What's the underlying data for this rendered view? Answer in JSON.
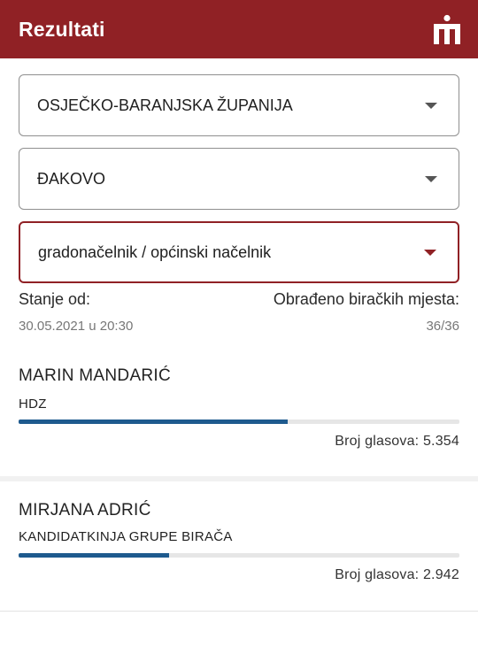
{
  "header": {
    "title": "Rezultati",
    "logo_icon": "hrt-logo-icon",
    "brand_color": "#902125"
  },
  "filters": {
    "county": "OSJEČKO-BARANJSKA ŽUPANIJA",
    "city": "ĐAKOVO",
    "office": "gradonačelnik / općinski načelnik"
  },
  "status": {
    "as_of_label": "Stanje od:",
    "as_of_value": "30.05.2021 u 20:30",
    "processed_label": "Obrađeno biračkih mjesta:",
    "processed_value": "36/36"
  },
  "candidates": [
    {
      "name": "MARIN MANDARIĆ",
      "party": "HDZ",
      "votes_text": "Broj glasova: 5.354",
      "share": 0.611,
      "bar_color": "#1e5a8e"
    },
    {
      "name": "MIRJANA ADRIĆ",
      "party": "KANDIDATKINJA GRUPE BIRAČA",
      "votes_text": "Broj glasova: 2.942",
      "share": 0.341,
      "bar_color": "#1e5a8e"
    }
  ]
}
